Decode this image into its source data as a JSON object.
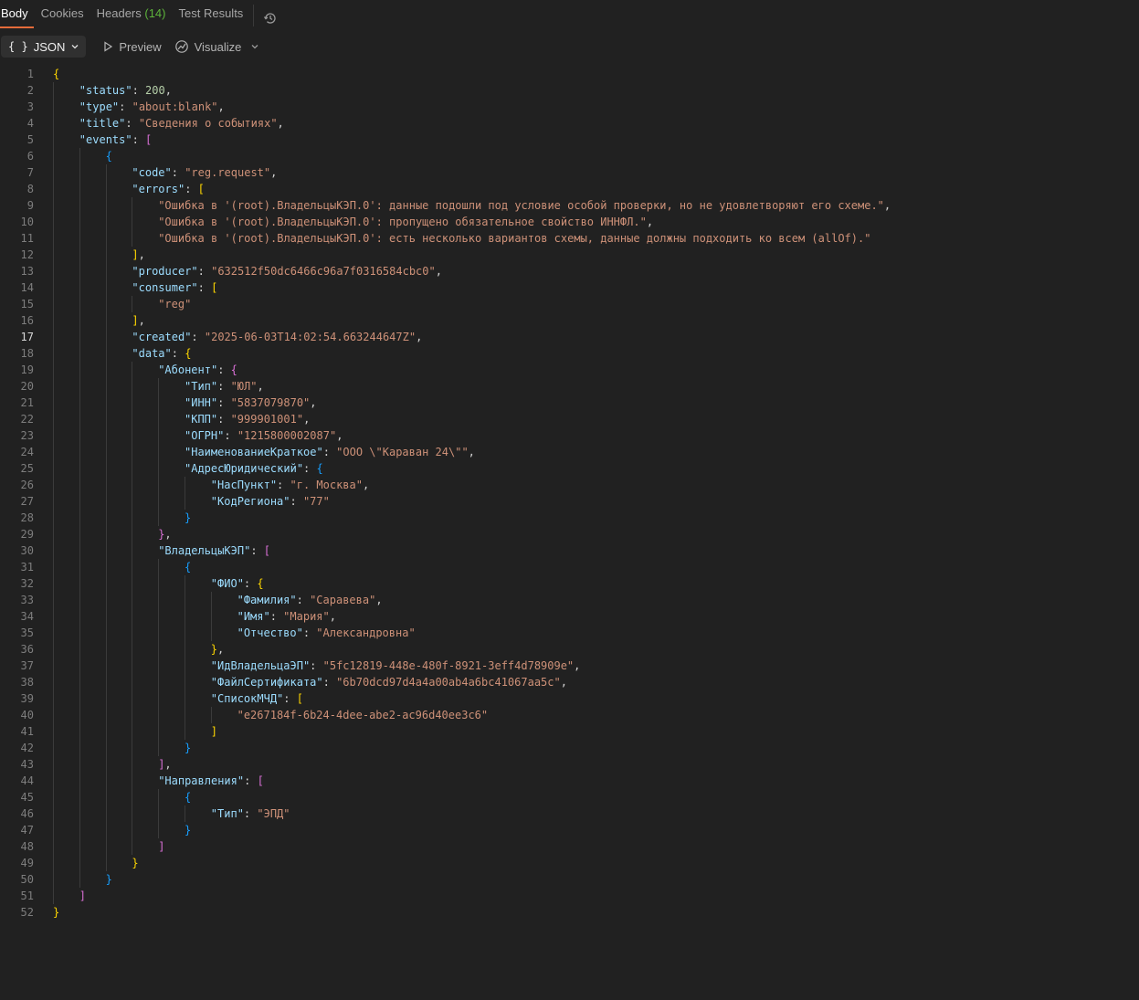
{
  "tabs": [
    {
      "label": "Body"
    },
    {
      "label": "Cookies"
    },
    {
      "label": "Headers",
      "count": "(14)"
    },
    {
      "label": "Test Results"
    }
  ],
  "toolbar": {
    "format_icon": "{ }",
    "format_label": "JSON",
    "preview_label": "Preview",
    "visualize_label": "Visualize"
  },
  "editor": {
    "current_line": 17,
    "lines": [
      {
        "n": 1,
        "indent": 0,
        "tokens": [
          [
            "{",
            "b1"
          ]
        ]
      },
      {
        "n": 2,
        "indent": 1,
        "tokens": [
          [
            "\"status\"",
            "k"
          ],
          [
            ": ",
            "p"
          ],
          [
            "200",
            "n"
          ],
          [
            ",",
            "p"
          ]
        ]
      },
      {
        "n": 3,
        "indent": 1,
        "tokens": [
          [
            "\"type\"",
            "k"
          ],
          [
            ": ",
            "p"
          ],
          [
            "\"about:blank\"",
            "s"
          ],
          [
            ",",
            "p"
          ]
        ]
      },
      {
        "n": 4,
        "indent": 1,
        "tokens": [
          [
            "\"title\"",
            "k"
          ],
          [
            ": ",
            "p"
          ],
          [
            "\"Сведения о событиях\"",
            "s"
          ],
          [
            ",",
            "p"
          ]
        ]
      },
      {
        "n": 5,
        "indent": 1,
        "tokens": [
          [
            "\"events\"",
            "k"
          ],
          [
            ": ",
            "p"
          ],
          [
            "[",
            "b2"
          ]
        ]
      },
      {
        "n": 6,
        "indent": 2,
        "tokens": [
          [
            "{",
            "b3"
          ]
        ]
      },
      {
        "n": 7,
        "indent": 3,
        "tokens": [
          [
            "\"code\"",
            "k"
          ],
          [
            ": ",
            "p"
          ],
          [
            "\"reg.request\"",
            "s"
          ],
          [
            ",",
            "p"
          ]
        ]
      },
      {
        "n": 8,
        "indent": 3,
        "tokens": [
          [
            "\"errors\"",
            "k"
          ],
          [
            ": ",
            "p"
          ],
          [
            "[",
            "b1"
          ]
        ]
      },
      {
        "n": 9,
        "indent": 4,
        "tokens": [
          [
            "\"Ошибка в '(root).ВладельцыКЭП.0': данные подошли под условие особой проверки, но не удовлетворяют его схеме.\"",
            "s"
          ],
          [
            ",",
            "p"
          ]
        ]
      },
      {
        "n": 10,
        "indent": 4,
        "tokens": [
          [
            "\"Ошибка в '(root).ВладельцыКЭП.0': пропущено обязательное свойство ИННФЛ.\"",
            "s"
          ],
          [
            ",",
            "p"
          ]
        ]
      },
      {
        "n": 11,
        "indent": 4,
        "tokens": [
          [
            "\"Ошибка в '(root).ВладельцыКЭП.0': есть несколько вариантов схемы, данные должны подходить ко всем (allOf).\"",
            "s"
          ]
        ]
      },
      {
        "n": 12,
        "indent": 3,
        "tokens": [
          [
            "]",
            "b1"
          ],
          [
            ",",
            "p"
          ]
        ]
      },
      {
        "n": 13,
        "indent": 3,
        "tokens": [
          [
            "\"producer\"",
            "k"
          ],
          [
            ": ",
            "p"
          ],
          [
            "\"632512f50dc6466c96a7f0316584cbc0\"",
            "s"
          ],
          [
            ",",
            "p"
          ]
        ]
      },
      {
        "n": 14,
        "indent": 3,
        "tokens": [
          [
            "\"consumer\"",
            "k"
          ],
          [
            ": ",
            "p"
          ],
          [
            "[",
            "b1"
          ]
        ]
      },
      {
        "n": 15,
        "indent": 4,
        "tokens": [
          [
            "\"reg\"",
            "s"
          ]
        ]
      },
      {
        "n": 16,
        "indent": 3,
        "tokens": [
          [
            "]",
            "b1"
          ],
          [
            ",",
            "p"
          ]
        ]
      },
      {
        "n": 17,
        "indent": 3,
        "tokens": [
          [
            "\"created\"",
            "k"
          ],
          [
            ": ",
            "p"
          ],
          [
            "\"2025-06-03T14:02:54.663244647Z\"",
            "s"
          ],
          [
            ",",
            "p"
          ]
        ]
      },
      {
        "n": 18,
        "indent": 3,
        "tokens": [
          [
            "\"data\"",
            "k"
          ],
          [
            ": ",
            "p"
          ],
          [
            "{",
            "b1"
          ]
        ]
      },
      {
        "n": 19,
        "indent": 4,
        "tokens": [
          [
            "\"Абонент\"",
            "k"
          ],
          [
            ": ",
            "p"
          ],
          [
            "{",
            "b2"
          ]
        ]
      },
      {
        "n": 20,
        "indent": 5,
        "tokens": [
          [
            "\"Тип\"",
            "k"
          ],
          [
            ": ",
            "p"
          ],
          [
            "\"ЮЛ\"",
            "s"
          ],
          [
            ",",
            "p"
          ]
        ]
      },
      {
        "n": 21,
        "indent": 5,
        "tokens": [
          [
            "\"ИНН\"",
            "k"
          ],
          [
            ": ",
            "p"
          ],
          [
            "\"5837079870\"",
            "s"
          ],
          [
            ",",
            "p"
          ]
        ]
      },
      {
        "n": 22,
        "indent": 5,
        "tokens": [
          [
            "\"КПП\"",
            "k"
          ],
          [
            ": ",
            "p"
          ],
          [
            "\"999901001\"",
            "s"
          ],
          [
            ",",
            "p"
          ]
        ]
      },
      {
        "n": 23,
        "indent": 5,
        "tokens": [
          [
            "\"ОГРН\"",
            "k"
          ],
          [
            ": ",
            "p"
          ],
          [
            "\"1215800002087\"",
            "s"
          ],
          [
            ",",
            "p"
          ]
        ]
      },
      {
        "n": 24,
        "indent": 5,
        "tokens": [
          [
            "\"НаименованиеКраткое\"",
            "k"
          ],
          [
            ": ",
            "p"
          ],
          [
            "\"ООО \\\"Караван 24\\\"\"",
            "s"
          ],
          [
            ",",
            "p"
          ]
        ]
      },
      {
        "n": 25,
        "indent": 5,
        "tokens": [
          [
            "\"АдресЮридический\"",
            "k"
          ],
          [
            ": ",
            "p"
          ],
          [
            "{",
            "b3"
          ]
        ]
      },
      {
        "n": 26,
        "indent": 6,
        "tokens": [
          [
            "\"НасПункт\"",
            "k"
          ],
          [
            ": ",
            "p"
          ],
          [
            "\"г. Москва\"",
            "s"
          ],
          [
            ",",
            "p"
          ]
        ]
      },
      {
        "n": 27,
        "indent": 6,
        "tokens": [
          [
            "\"КодРегиона\"",
            "k"
          ],
          [
            ": ",
            "p"
          ],
          [
            "\"77\"",
            "s"
          ]
        ]
      },
      {
        "n": 28,
        "indent": 5,
        "tokens": [
          [
            "}",
            "b3"
          ]
        ]
      },
      {
        "n": 29,
        "indent": 4,
        "tokens": [
          [
            "}",
            "b2"
          ],
          [
            ",",
            "p"
          ]
        ]
      },
      {
        "n": 30,
        "indent": 4,
        "tokens": [
          [
            "\"ВладельцыКЭП\"",
            "k"
          ],
          [
            ": ",
            "p"
          ],
          [
            "[",
            "b2"
          ]
        ]
      },
      {
        "n": 31,
        "indent": 5,
        "tokens": [
          [
            "{",
            "b3"
          ]
        ]
      },
      {
        "n": 32,
        "indent": 6,
        "tokens": [
          [
            "\"ФИО\"",
            "k"
          ],
          [
            ": ",
            "p"
          ],
          [
            "{",
            "b1"
          ]
        ]
      },
      {
        "n": 33,
        "indent": 7,
        "tokens": [
          [
            "\"Фамилия\"",
            "k"
          ],
          [
            ": ",
            "p"
          ],
          [
            "\"Саравева\"",
            "s"
          ],
          [
            ",",
            "p"
          ]
        ]
      },
      {
        "n": 34,
        "indent": 7,
        "tokens": [
          [
            "\"Имя\"",
            "k"
          ],
          [
            ": ",
            "p"
          ],
          [
            "\"Мария\"",
            "s"
          ],
          [
            ",",
            "p"
          ]
        ]
      },
      {
        "n": 35,
        "indent": 7,
        "tokens": [
          [
            "\"Отчество\"",
            "k"
          ],
          [
            ": ",
            "p"
          ],
          [
            "\"Александровна\"",
            "s"
          ]
        ]
      },
      {
        "n": 36,
        "indent": 6,
        "tokens": [
          [
            "}",
            "b1"
          ],
          [
            ",",
            "p"
          ]
        ]
      },
      {
        "n": 37,
        "indent": 6,
        "tokens": [
          [
            "\"ИдВладельцаЭП\"",
            "k"
          ],
          [
            ": ",
            "p"
          ],
          [
            "\"5fc12819-448e-480f-8921-3eff4d78909e\"",
            "s"
          ],
          [
            ",",
            "p"
          ]
        ]
      },
      {
        "n": 38,
        "indent": 6,
        "tokens": [
          [
            "\"ФайлСертификата\"",
            "k"
          ],
          [
            ": ",
            "p"
          ],
          [
            "\"6b70dcd97d4a4a00ab4a6bc41067aa5c\"",
            "s"
          ],
          [
            ",",
            "p"
          ]
        ]
      },
      {
        "n": 39,
        "indent": 6,
        "tokens": [
          [
            "\"СписокМЧД\"",
            "k"
          ],
          [
            ": ",
            "p"
          ],
          [
            "[",
            "b1"
          ]
        ]
      },
      {
        "n": 40,
        "indent": 7,
        "tokens": [
          [
            "\"e267184f-6b24-4dee-abe2-ac96d40ee3c6\"",
            "s"
          ]
        ]
      },
      {
        "n": 41,
        "indent": 6,
        "tokens": [
          [
            "]",
            "b1"
          ]
        ]
      },
      {
        "n": 42,
        "indent": 5,
        "tokens": [
          [
            "}",
            "b3"
          ]
        ]
      },
      {
        "n": 43,
        "indent": 4,
        "tokens": [
          [
            "]",
            "b2"
          ],
          [
            ",",
            "p"
          ]
        ]
      },
      {
        "n": 44,
        "indent": 4,
        "tokens": [
          [
            "\"Направления\"",
            "k"
          ],
          [
            ": ",
            "p"
          ],
          [
            "[",
            "b2"
          ]
        ]
      },
      {
        "n": 45,
        "indent": 5,
        "tokens": [
          [
            "{",
            "b3"
          ]
        ]
      },
      {
        "n": 46,
        "indent": 6,
        "tokens": [
          [
            "\"Тип\"",
            "k"
          ],
          [
            ": ",
            "p"
          ],
          [
            "\"ЭПД\"",
            "s"
          ]
        ]
      },
      {
        "n": 47,
        "indent": 5,
        "tokens": [
          [
            "}",
            "b3"
          ]
        ]
      },
      {
        "n": 48,
        "indent": 4,
        "tokens": [
          [
            "]",
            "b2"
          ]
        ]
      },
      {
        "n": 49,
        "indent": 3,
        "tokens": [
          [
            "}",
            "b1"
          ]
        ]
      },
      {
        "n": 50,
        "indent": 2,
        "tokens": [
          [
            "}",
            "b3"
          ]
        ]
      },
      {
        "n": 51,
        "indent": 1,
        "tokens": [
          [
            "]",
            "b2"
          ]
        ]
      },
      {
        "n": 52,
        "indent": 0,
        "tokens": [
          [
            "}",
            "b1"
          ]
        ]
      }
    ]
  }
}
